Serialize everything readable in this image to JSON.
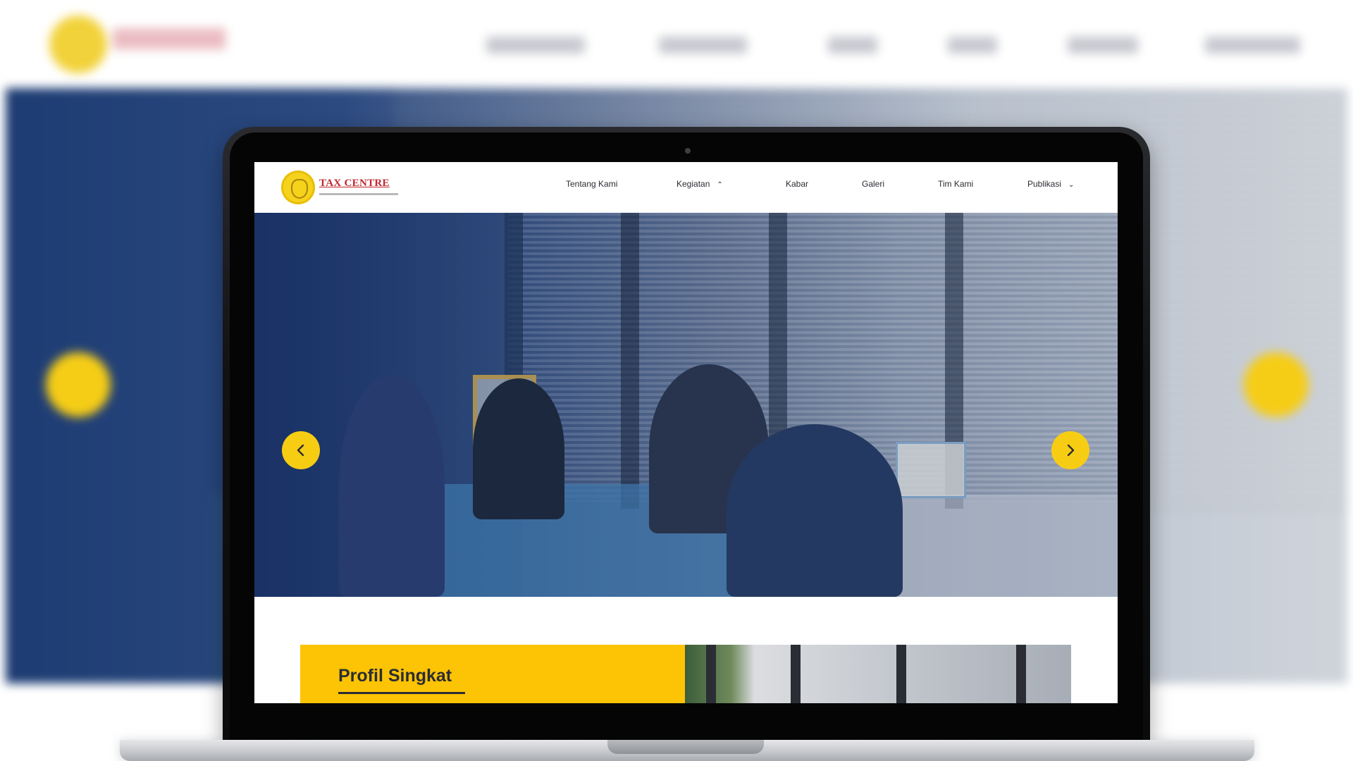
{
  "site": {
    "logo_name": "TAX CENTRE",
    "nav": [
      {
        "label": "Tentang Kami"
      },
      {
        "label": "Kegiatan",
        "icon": "chevron-up-icon"
      },
      {
        "label": "Kabar"
      },
      {
        "label": "Galeri"
      },
      {
        "label": "Tim Kami"
      },
      {
        "label": "Publikasi",
        "icon": "chevron-down-icon"
      }
    ]
  },
  "hero": {
    "prev_icon": "chevron-left-icon",
    "next_icon": "chevron-right-icon"
  },
  "profile": {
    "title": "Profil Singkat"
  },
  "colors": {
    "accent": "#fdc405",
    "hero_overlay": "#253f73",
    "logo_red": "#c0272d"
  }
}
